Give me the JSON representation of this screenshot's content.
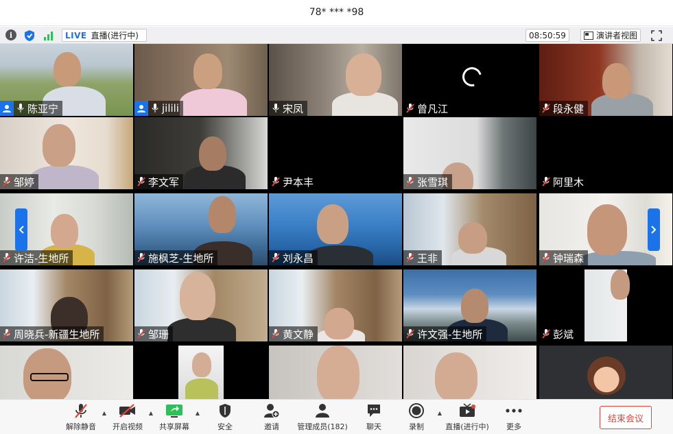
{
  "window": {
    "title": "78* *** *98"
  },
  "infobar": {
    "info_icon": "i",
    "live_badge": "LIVE",
    "live_status": "直播(进行中)",
    "clock": "08:50:59",
    "speaker_view": "演讲者视图"
  },
  "participants": [
    {
      "name": "陈亚宁",
      "host": true,
      "muted": false
    },
    {
      "name": "jilili",
      "host": true,
      "muted": false
    },
    {
      "name": "宋凤",
      "host": false,
      "muted": false
    },
    {
      "name": "曾凡江",
      "host": false,
      "muted": true
    },
    {
      "name": "段永健",
      "host": false,
      "muted": true
    },
    {
      "name": "邹婷",
      "host": false,
      "muted": true
    },
    {
      "name": "李文军",
      "host": false,
      "muted": true
    },
    {
      "name": "尹本丰",
      "host": false,
      "muted": true
    },
    {
      "name": "张雪琪",
      "host": false,
      "muted": true
    },
    {
      "name": "阿里木",
      "host": false,
      "muted": true
    },
    {
      "name": "许洁-生地所",
      "host": false,
      "muted": true
    },
    {
      "name": "施枫芝-生地所",
      "host": false,
      "muted": true
    },
    {
      "name": "刘永昌",
      "host": false,
      "muted": true
    },
    {
      "name": "王非",
      "host": false,
      "muted": true
    },
    {
      "name": "钟瑞森",
      "host": false,
      "muted": true
    },
    {
      "name": "周晓兵-新疆生地所",
      "host": false,
      "muted": true
    },
    {
      "name": "邹珊",
      "host": false,
      "muted": true
    },
    {
      "name": "黄文静",
      "host": false,
      "muted": true
    },
    {
      "name": "许文强-生地所",
      "host": false,
      "muted": true
    },
    {
      "name": "彭斌",
      "host": false,
      "muted": true
    }
  ],
  "toolbar": {
    "unmute": "解除静音",
    "start_video": "开启视频",
    "share_screen": "共享屏幕",
    "security": "安全",
    "invite": "邀请",
    "participants": "管理成员(182)",
    "chat": "聊天",
    "record": "录制",
    "live": "直播(进行中)",
    "more": "更多",
    "end_meeting": "结束会议"
  },
  "colors": {
    "accent": "#1a73e8",
    "end": "#e0453a",
    "active_speaker": "#2fbf5a"
  }
}
